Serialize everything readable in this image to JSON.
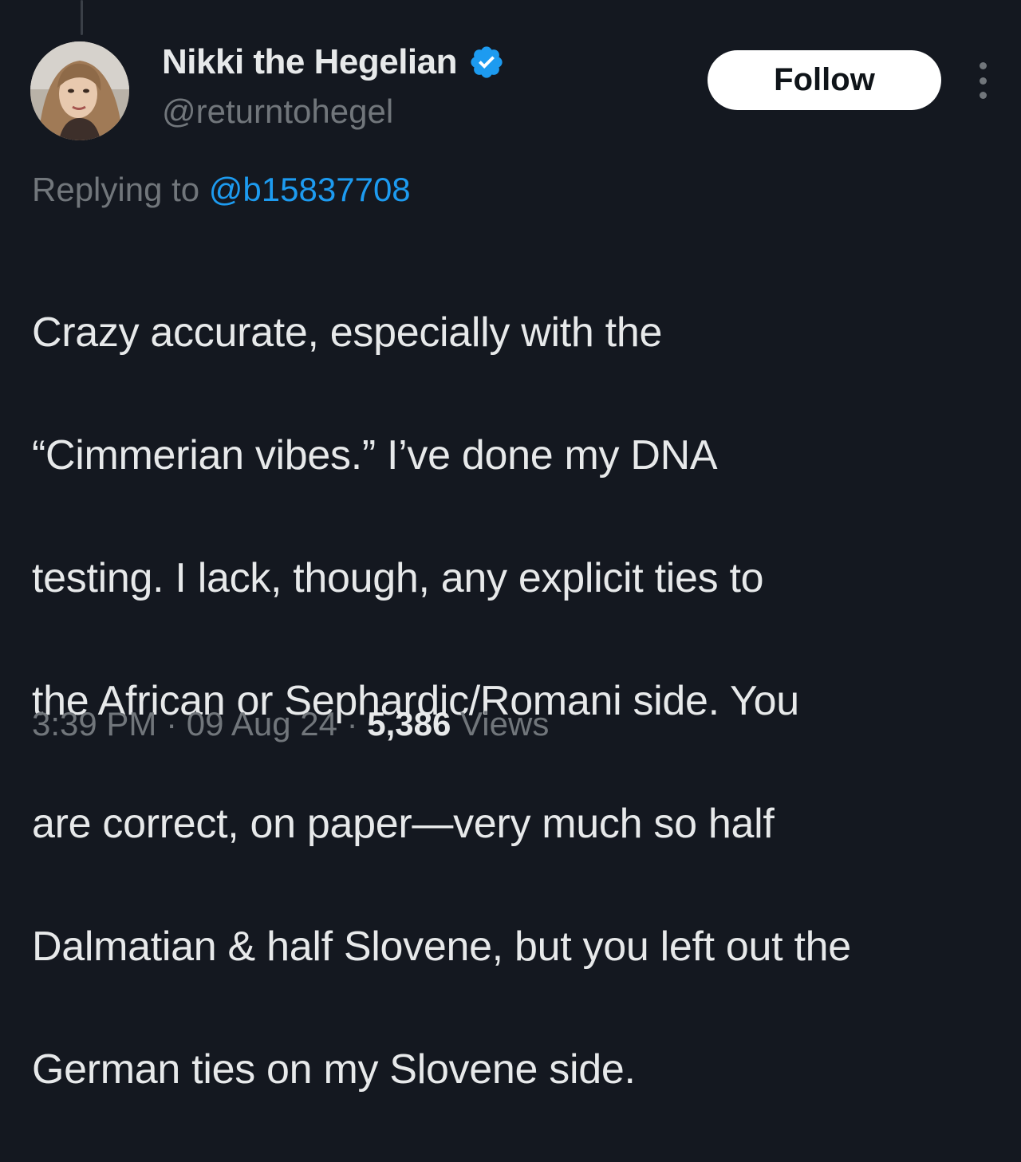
{
  "author": {
    "display_name": "Nikki the Hegelian",
    "handle": "@returntohegel",
    "verified": true,
    "avatar_icon": "profile-photo"
  },
  "actions": {
    "follow_label": "Follow",
    "more_icon": "more-dots-icon"
  },
  "reply": {
    "prefix": "Replying to ",
    "handle": "@b15837708"
  },
  "tweet": {
    "lines": [
      "Crazy accurate, especially with the",
      "“Cimmerian vibes.” I’ve done my DNA",
      "testing. I lack, though, any explicit ties to",
      "the African or Sephardic/Romani side. You",
      "are correct, on paper—very much so half",
      "Dalmatian & half Slovene, but you left out the",
      "German ties on my Slovene side."
    ]
  },
  "meta": {
    "time": "3:39 PM",
    "separator": " · ",
    "date": "09 Aug 24",
    "views_count": "5,386",
    "views_label": " Views"
  },
  "colors": {
    "background": "#141820",
    "text": "#e7e9ea",
    "muted": "#71767b",
    "link": "#1d9bf0",
    "verified": "#1d9bf0",
    "follow_bg": "#ffffff"
  }
}
